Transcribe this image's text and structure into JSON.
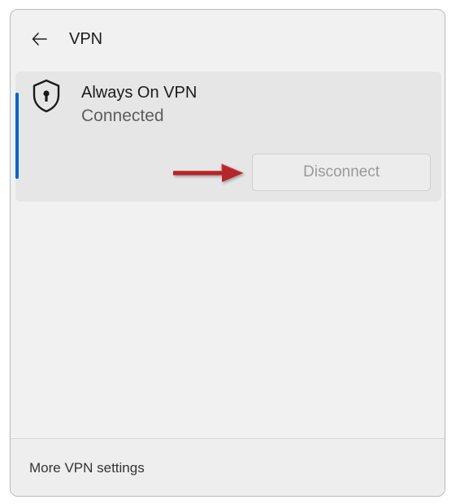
{
  "header": {
    "title": "VPN",
    "back_icon": "arrow-left-icon"
  },
  "connection": {
    "name": "Always On VPN",
    "status": "Connected",
    "icon": "shield-lock-icon",
    "accent_color": "#0067c0",
    "disconnect_label": "Disconnect",
    "disconnect_enabled": false
  },
  "annotation": {
    "icon": "red-arrow-icon",
    "color": "#b5282a"
  },
  "footer": {
    "more_settings_label": "More VPN settings"
  }
}
